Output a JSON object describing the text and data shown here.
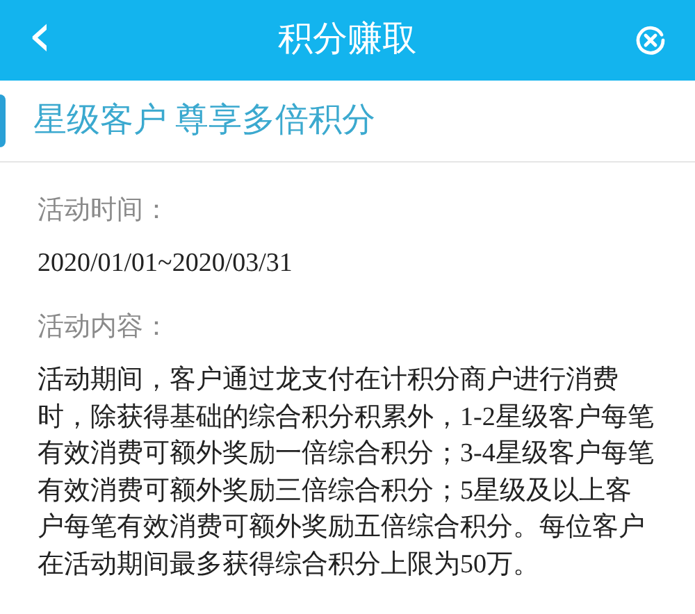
{
  "header": {
    "back_icon": "‹",
    "title": "积分赚取"
  },
  "banner": {
    "title": "星级客户 尊享多倍积分"
  },
  "sections": [
    {
      "label": "活动时间：",
      "text": "2020/01/01~2020/03/31",
      "kind": "date"
    },
    {
      "label": "活动内容：",
      "text": "活动期间，客户通过龙支付在计积分商户进行消费时，除获得基础的综合积分积累外，1-2星级客户每笔有效消费可额外奖励一倍综合积分；3-4星级客户每笔有效消费可额外奖励三倍综合积分；5星级及以上客户每笔有效消费可额外奖励五倍综合积分。每位客户在活动期间最多获得综合积分上限为50万。",
      "kind": "paragraph"
    }
  ]
}
